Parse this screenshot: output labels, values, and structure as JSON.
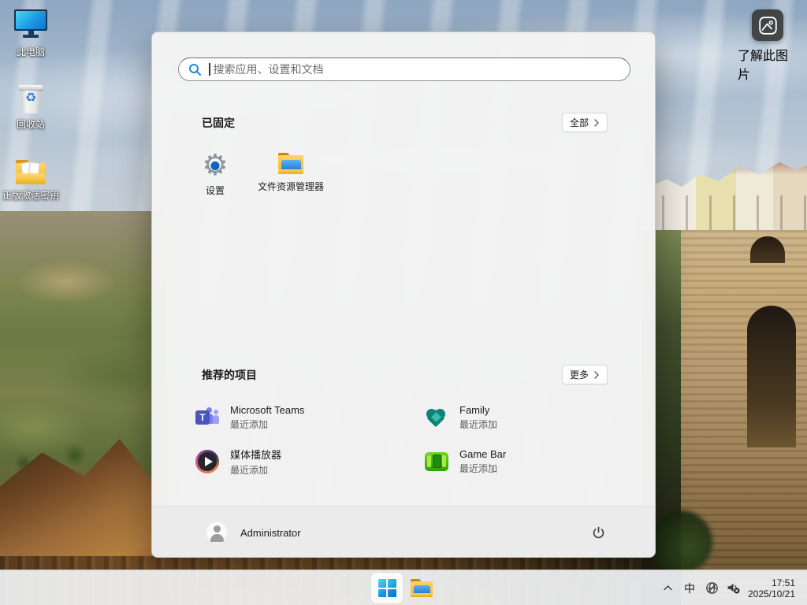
{
  "desktop": {
    "icons": [
      {
        "label": "此电脑"
      },
      {
        "label": "回收站"
      },
      {
        "label": "正版激活密钥"
      }
    ],
    "learn_picture": {
      "label": "了解此图片"
    }
  },
  "start_menu": {
    "search": {
      "placeholder": "搜索应用、设置和文档"
    },
    "pinned": {
      "title": "已固定",
      "all_button": "全部",
      "apps": [
        {
          "label": "设置"
        },
        {
          "label": "文件资源管理器"
        }
      ]
    },
    "recommended": {
      "title": "推荐的项目",
      "more_button": "更多",
      "items": [
        {
          "title": "Microsoft Teams",
          "subtitle": "最近添加",
          "icon_letter": "T"
        },
        {
          "title": "Family",
          "subtitle": "最近添加"
        },
        {
          "title": "媒体播放器",
          "subtitle": "最近添加"
        },
        {
          "title": "Game Bar",
          "subtitle": "最近添加"
        }
      ]
    },
    "user": {
      "name": "Administrator"
    }
  },
  "taskbar": {
    "ime": "中",
    "clock": {
      "time": "17:51",
      "date": "2025/10/21"
    }
  },
  "colors": {
    "accent": "#0067c0",
    "menu_bg": "#f3f3f3",
    "taskbar_bg": "#f2f4f6"
  }
}
